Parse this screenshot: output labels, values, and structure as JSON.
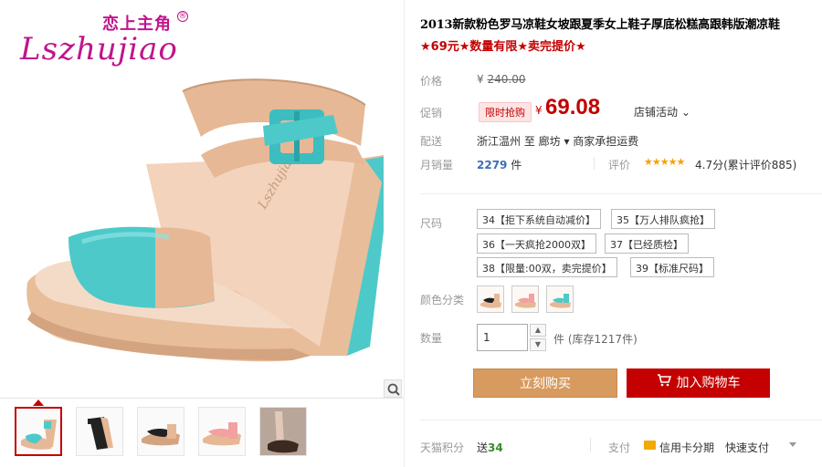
{
  "brand": {
    "cn_text": "恋上主角",
    "script_text": "Lszhujiao",
    "reg_mark": "®",
    "color": "#c0148c"
  },
  "product": {
    "title": "2013新款粉色罗马凉鞋女坡跟夏季女上鞋子厚底松糕高跟韩版潮凉鞋",
    "promo": "★69元★数量有限★卖完提价★"
  },
  "price": {
    "label": "价格",
    "currency": "¥",
    "original": "240.00",
    "promo_label": "促销",
    "badge": "限时抢购",
    "current": "69.08",
    "store_activity": "店铺活动"
  },
  "shipping": {
    "label": "配送",
    "text": "浙江温州 至 廊坊 ▾ 商家承担运费"
  },
  "sales": {
    "label": "月销量",
    "count": "2279",
    "unit": "件",
    "review_label": "评价",
    "stars": "★★★★★",
    "rating": "4.7分(累计评价885)"
  },
  "sizes": {
    "label": "尺码",
    "options": [
      "34【拒下系统自动减价】",
      "35【万人排队疯抢】",
      "36【一天疯抢2000双】",
      "37【已经质检】",
      "38【限量:00双，卖完提价】",
      "39【标准尺码】"
    ]
  },
  "colors": {
    "label": "颜色分类",
    "options": [
      "black-variant",
      "pink-variant",
      "teal-variant"
    ]
  },
  "quantity": {
    "label": "数量",
    "value": "1",
    "unit": "件",
    "stock": "(库存1217件)"
  },
  "actions": {
    "buy_now": "立刻购买",
    "add_cart": "加入购物车"
  },
  "footer": {
    "points_label": "天猫积分",
    "points_prefix": "送",
    "points_value": "34",
    "pay_label": "支付",
    "pay_card": "信用卡分期",
    "pay_quick": "快速支付"
  },
  "colors_theme": {
    "accent_red": "#c40000",
    "buy_orange": "#d79b5f",
    "shoe_teal": "#4ec9c9",
    "shoe_tan": "#e6b896"
  }
}
